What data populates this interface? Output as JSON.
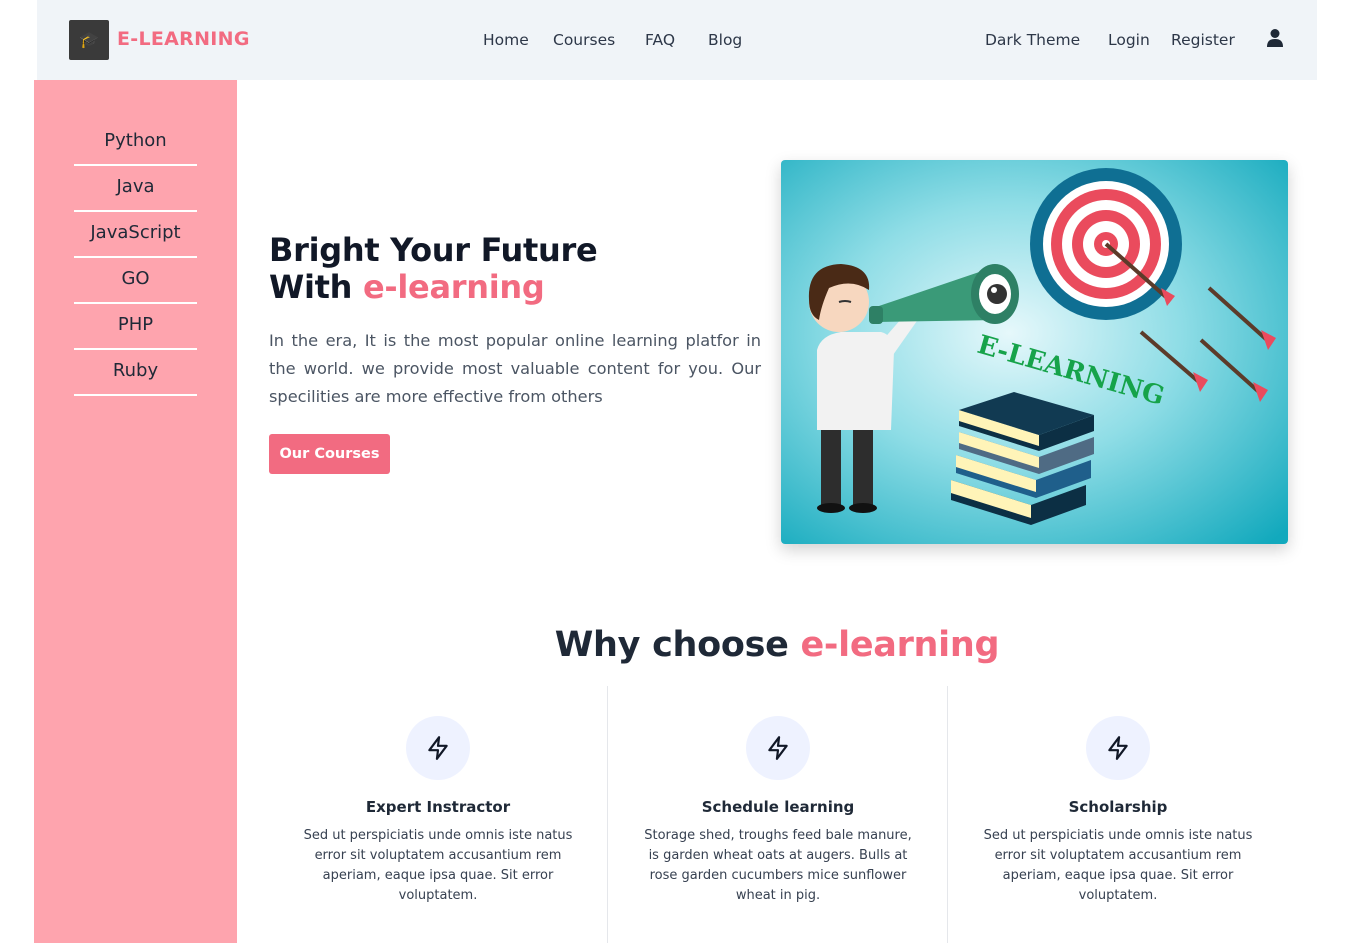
{
  "nav": {
    "brand": "E-LEARNING",
    "links": [
      "Home",
      "Courses",
      "FAQ",
      "Blog"
    ],
    "theme_toggle": "Dark Theme",
    "login": "Login",
    "register": "Register",
    "user_icon": "user-icon"
  },
  "sidebar": {
    "items": [
      "Python",
      "Java",
      "JavaScript",
      "GO",
      "PHP",
      "Ruby"
    ]
  },
  "hero": {
    "title_line1": "Bright Your Future",
    "title_line2_plain": "With ",
    "title_line2_accent": "e-learning",
    "description": "In the era, It is the most popular online learning platfor in the world. we provide most valuable content for you. Our specilities are more effective from others",
    "button": "Our Courses",
    "image_text": "E-LEARNING"
  },
  "why": {
    "title_plain": "Why choose ",
    "title_accent": "e-learning",
    "features": [
      {
        "icon": "lightning-icon",
        "title": "Expert Instractor",
        "text": "Sed ut perspiciatis unde omnis iste natus error sit voluptatem accusantium rem aperiam, eaque ipsa quae. Sit error voluptatem."
      },
      {
        "icon": "lightning-icon",
        "title": "Schedule learning",
        "text": "Storage shed, troughs feed bale manure, is garden wheat oats at augers. Bulls at rose garden cucumbers mice sunflower wheat in pig."
      },
      {
        "icon": "lightning-icon",
        "title": "Scholarship",
        "text": "Sed ut perspiciatis unde omnis iste natus error sit voluptatem accusantium rem aperiam, eaque ipsa quae. Sit error voluptatem."
      }
    ]
  },
  "colors": {
    "accent": "#f26b81",
    "sidebar_bg": "#fea4ae",
    "navbar_bg": "#f0f4f8"
  }
}
